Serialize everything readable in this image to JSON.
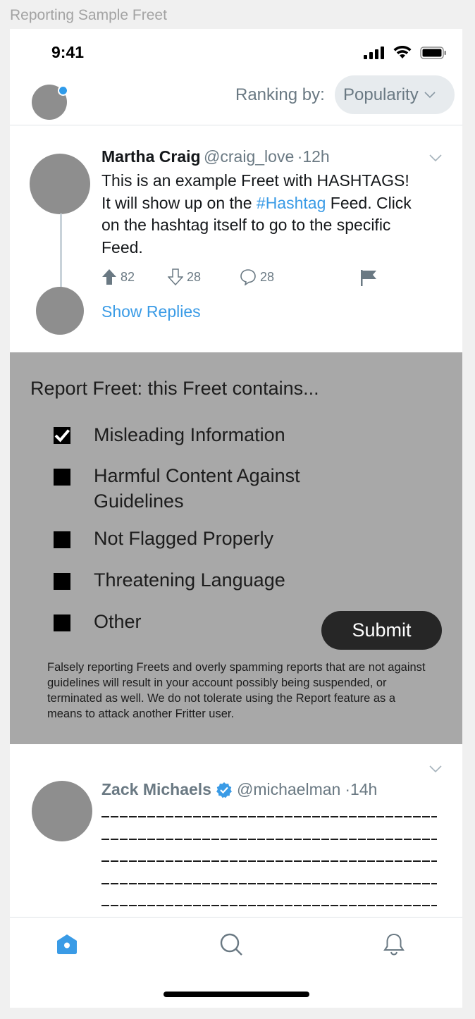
{
  "frame_title": "Reporting Sample Freet",
  "status_bar": {
    "time": "9:41"
  },
  "header": {
    "ranking_label": "Ranking by:",
    "ranking_value": "Popularity"
  },
  "freet1": {
    "author": "Martha Craig",
    "handle": "@craig_love",
    "time": "·12h",
    "body_before": "This is an example Freet with HASHTAGS! It will show up on the ",
    "hashtag": "#Hashtag",
    "body_after": " Feed. Click on the hashtag itself to go to the specific Feed.",
    "upvotes": "82",
    "downvotes": "28",
    "comments": "28",
    "show_replies": "Show Replies"
  },
  "report": {
    "title": "Report Freet: this Freet contains...",
    "options": [
      {
        "label": "Misleading Information",
        "checked": true
      },
      {
        "label": "Harmful Content Against Guidelines",
        "checked": false
      },
      {
        "label": "Not Flagged Properly",
        "checked": false
      },
      {
        "label": "Threatening Language",
        "checked": false
      },
      {
        "label": "Other",
        "checked": false
      }
    ],
    "submit": "Submit",
    "note": "Falsely reporting Freets and overly spamming reports that are not against guidelines will result in your account possibly being suspended, or terminated as well. We do not tolerate using the Report feature as a means to attack another Fritter user."
  },
  "freet2": {
    "author": "Zack Michaels",
    "handle": "@michaelman",
    "time": "·14h",
    "verified": true
  },
  "nav": [
    "home-icon",
    "search-icon",
    "notifications-icon"
  ],
  "colors": {
    "accent": "#3a9be6",
    "panel": "#a8a8a8",
    "avatar": "#8e8e8e"
  }
}
